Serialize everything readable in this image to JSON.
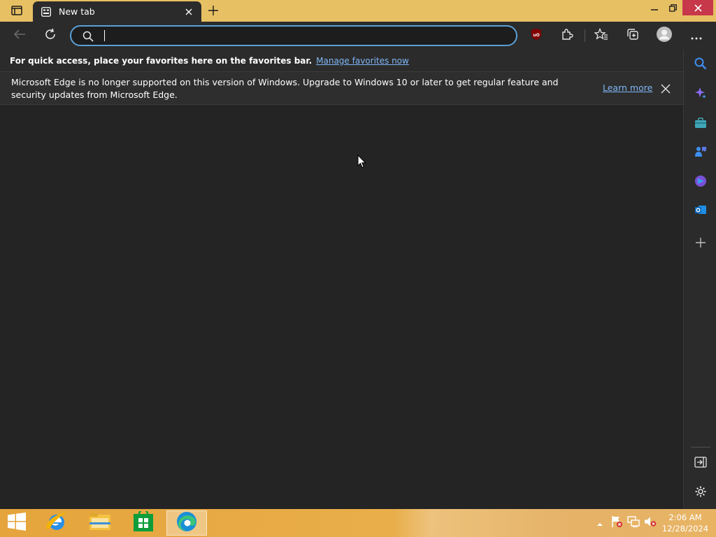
{
  "browser": {
    "tab": {
      "title": "New tab"
    },
    "address_bar": {
      "value": "",
      "placeholder": ""
    },
    "favorites_bar": {
      "text": "For quick access, place your favorites here on the favorites bar.",
      "link": "Manage favorites now"
    },
    "info_bar": {
      "message": "Microsoft Edge is no longer supported on this version of Windows. Upgrade to Windows 10 or later to get regular feature and security updates from Microsoft Edge.",
      "link": "Learn more"
    },
    "toolbar_icons": [
      "back-icon",
      "refresh-icon",
      "search-icon",
      "ublock-icon",
      "extensions-icon",
      "favorites-icon",
      "collections-icon",
      "profile-icon",
      "more-icon"
    ],
    "sidebar_icons": [
      "search-icon",
      "copilot-icon",
      "tools-icon",
      "games-icon",
      "office-icon",
      "outlook-icon",
      "add-icon",
      "hide-sidebar-icon",
      "settings-icon"
    ]
  },
  "taskbar": {
    "apps": [
      "internet-explorer",
      "file-explorer",
      "store",
      "edge"
    ],
    "tray_icons": [
      "show-hidden-icons",
      "action-center-flag-icon",
      "network-icon",
      "volume-muted-icon"
    ],
    "clock": {
      "time": "2:06 AM",
      "date": "12/28/2024"
    }
  },
  "colors": {
    "accent": "#e8c064",
    "link": "#7fb6f5",
    "close_red": "#c7384a",
    "content_bg": "#242424"
  }
}
